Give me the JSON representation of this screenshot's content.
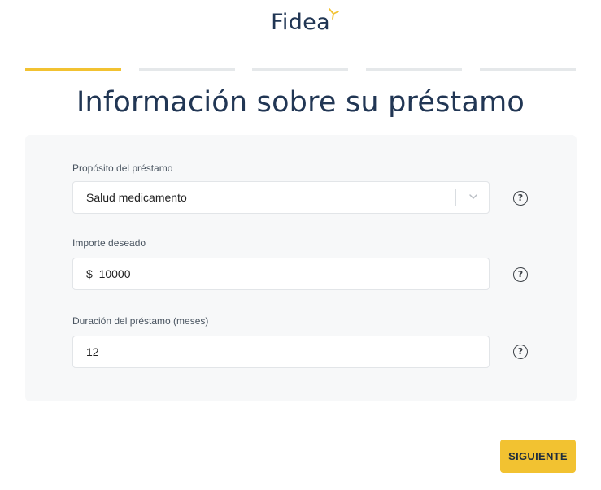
{
  "brand": {
    "name": "Fidea",
    "accent": "#f2c231",
    "text_color": "#213654"
  },
  "progress": {
    "steps": 5,
    "current": 1
  },
  "page": {
    "title": "Información sobre su préstamo"
  },
  "form": {
    "purpose": {
      "label": "Propósito del préstamo",
      "value": "Salud medicamento"
    },
    "amount": {
      "label": "Importe deseado",
      "currency": "$",
      "value": "10000"
    },
    "duration": {
      "label": "Duración del préstamo (meses)",
      "value": "12"
    }
  },
  "help_icon": {
    "glyph": "?",
    "icon": "help-circle-icon"
  },
  "actions": {
    "next_label": "SIGUIENTE"
  }
}
